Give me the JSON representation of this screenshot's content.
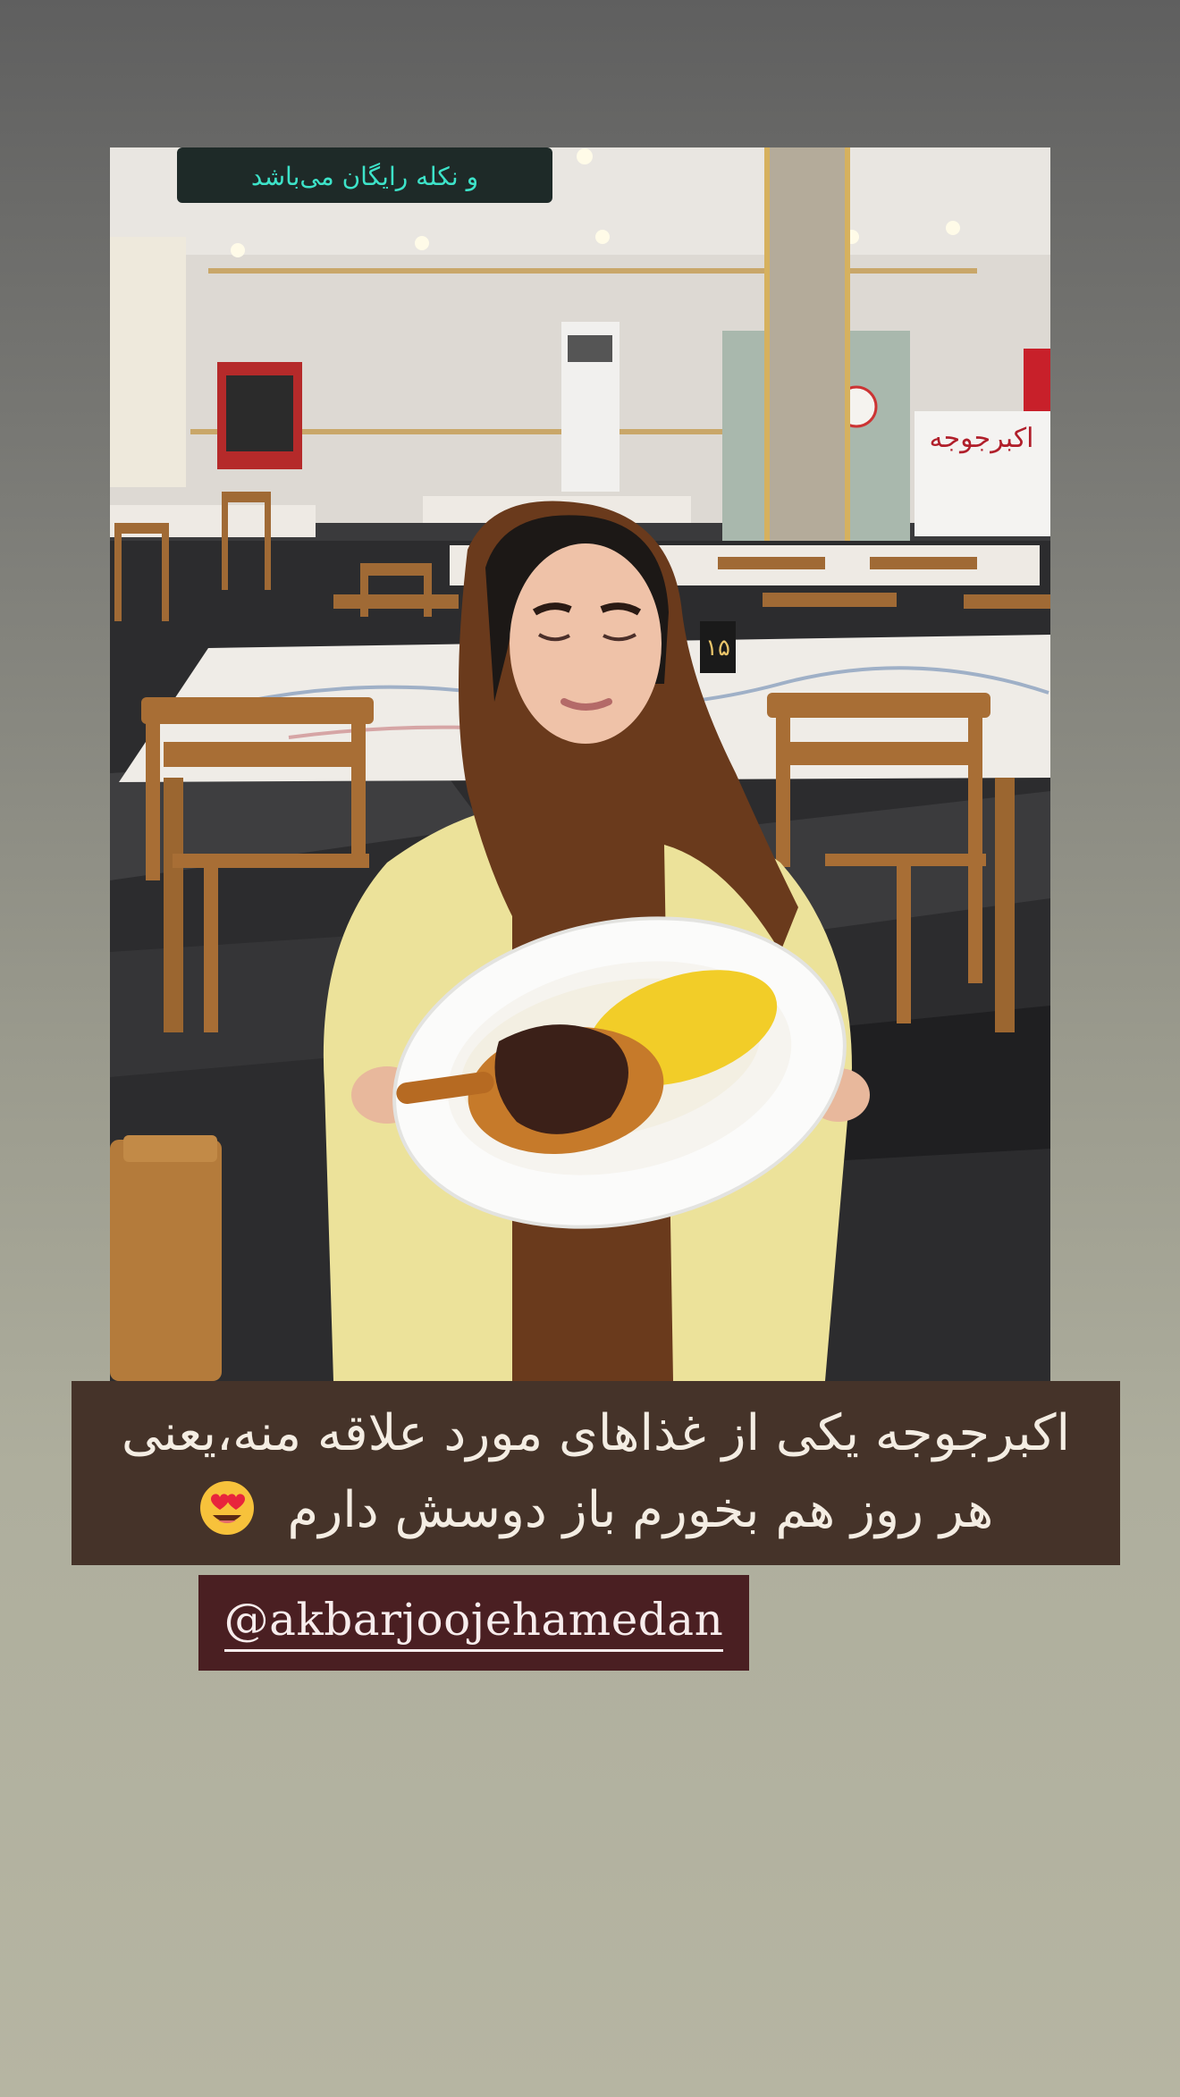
{
  "story": {
    "photo": {
      "sign_text": "و نکله رایگان می‌باشد",
      "wall_sign_text": "اکبرجوجه",
      "table_number": "۱۵"
    },
    "caption": {
      "line1": "اکبرجوجه یکی از غذاهای مورد علاقه منه،یعنی",
      "line2": "هر روز هم بخورم باز دوسش دارم",
      "emoji": "heart-eyes-emoji"
    },
    "mention": {
      "username": "@akbarjoojehamedan"
    }
  },
  "colors": {
    "caption_bg": "#453329",
    "mention_bg": "#4a1f22",
    "caption_text": "#f4ede3"
  }
}
